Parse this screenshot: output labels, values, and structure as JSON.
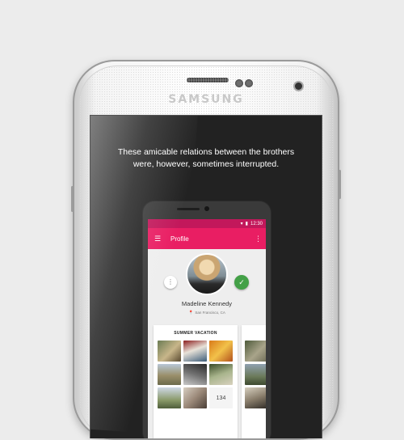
{
  "device": {
    "brand": "SAMSUNG",
    "quote_line1": "These amicable relations between the brothers",
    "quote_line2": "were, however, sometimes interrupted."
  },
  "app": {
    "status_time": "12:30",
    "toolbar_title": "Profile",
    "menu_icon": "☰",
    "more_icon": "⋮",
    "profile_name": "Madeline Kennedy",
    "profile_location": "San Francisco, CA",
    "location_icon": "📍",
    "left_action_icon": "⋮",
    "confirm_icon": "✓",
    "album_title": "SUMMER VACATION",
    "more_photos_count": "134",
    "accent_color": "#e91e63",
    "status_color": "#c2185b",
    "confirm_color": "#43a047"
  }
}
